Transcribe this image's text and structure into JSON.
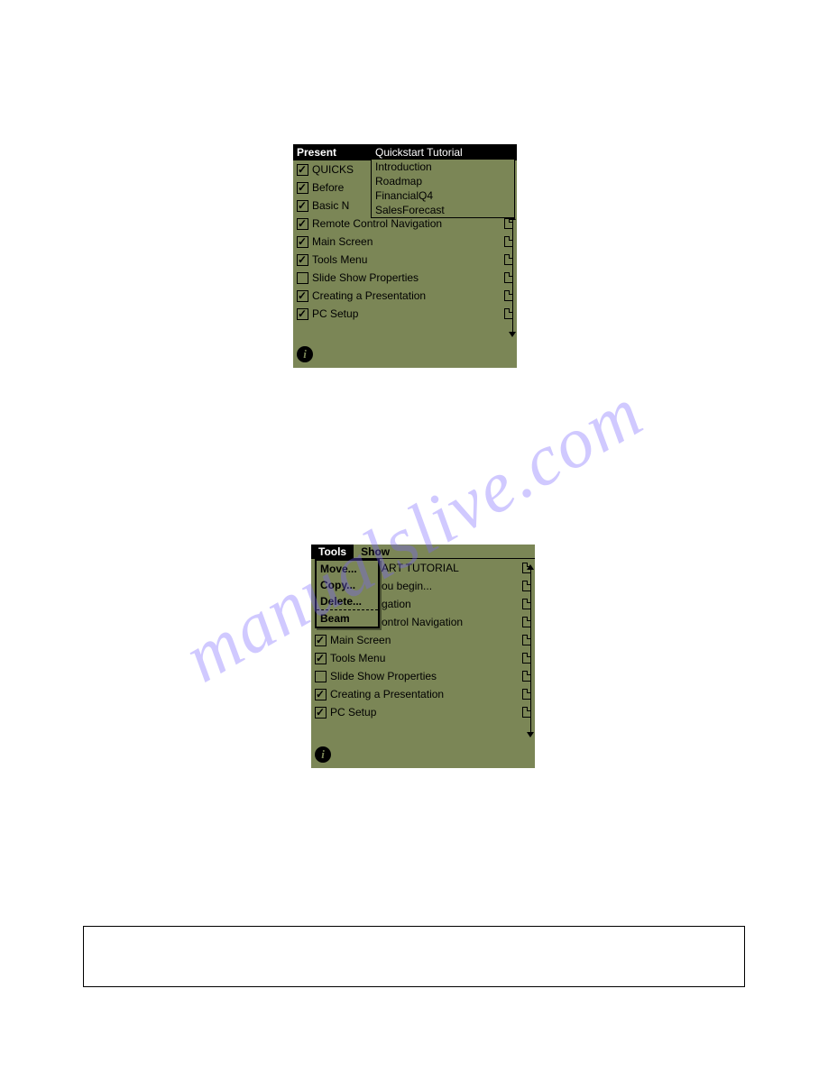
{
  "watermark": "manualslive.com",
  "screen1": {
    "title_truncated": "Present",
    "dropdown_header": "Quickstart Tutorial",
    "dropdown_items": [
      "Introduction",
      "Roadmap",
      "FinancialQ4",
      "SalesForecast"
    ],
    "rows": [
      {
        "checked": true,
        "label": "QUICKS",
        "note": false
      },
      {
        "checked": true,
        "label": "Before",
        "note": false
      },
      {
        "checked": true,
        "label": "Basic N",
        "note": false
      },
      {
        "checked": true,
        "label": "Remote Control Navigation",
        "note": true
      },
      {
        "checked": true,
        "label": "Main Screen",
        "note": true
      },
      {
        "checked": true,
        "label": "Tools Menu",
        "note": true
      },
      {
        "checked": false,
        "label": "Slide Show Properties",
        "note": true
      },
      {
        "checked": true,
        "label": "Creating a Presentation",
        "note": true
      },
      {
        "checked": true,
        "label": "PC Setup",
        "note": true
      }
    ]
  },
  "screen2": {
    "menubar": [
      "Tools",
      "Show"
    ],
    "tools_menu": [
      "Move...",
      "Copy...",
      "Delete...",
      "Beam"
    ],
    "rows": [
      {
        "checked": null,
        "label": "ART TUTORIAL",
        "note": true
      },
      {
        "checked": null,
        "label": "ou begin...",
        "note": true
      },
      {
        "checked": null,
        "label": "gation",
        "note": true
      },
      {
        "checked": null,
        "label": "ontrol Navigation",
        "note": true
      },
      {
        "checked": true,
        "label": "Main Screen",
        "note": true
      },
      {
        "checked": true,
        "label": "Tools Menu",
        "note": true
      },
      {
        "checked": false,
        "label": "Slide Show Properties",
        "note": true
      },
      {
        "checked": true,
        "label": "Creating a Presentation",
        "note": true
      },
      {
        "checked": true,
        "label": "PC Setup",
        "note": true
      }
    ]
  }
}
